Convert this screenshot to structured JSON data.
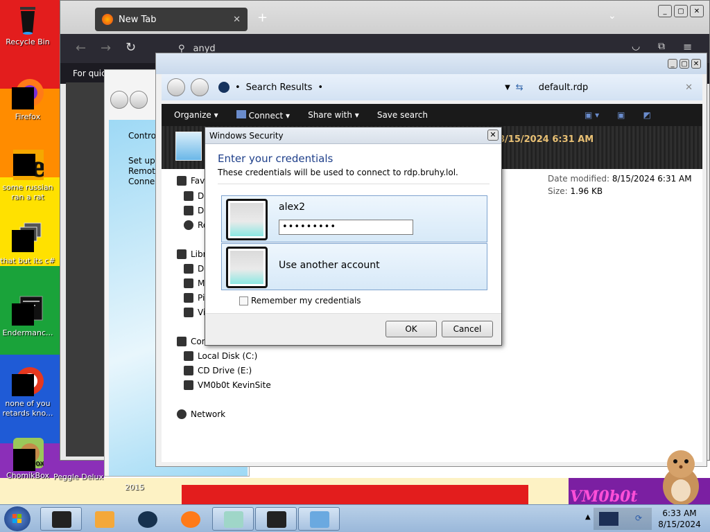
{
  "colors": {
    "accent": "#1e3f8a",
    "stripes": [
      "#e31d1d",
      "#ff8c00",
      "#ffe100",
      "#1aa33a",
      "#1f5bd6",
      "#8b2fb8"
    ]
  },
  "desktop": {
    "icons": [
      {
        "label": "Recycle Bin",
        "icon": "recycle-bin-icon"
      },
      {
        "label": "Firefox",
        "icon": "firefox-icon"
      },
      {
        "label": "some russian ran a rat",
        "icon": "ie-icon"
      },
      {
        "label": "that but its c#",
        "icon": "windows-stack-icon"
      },
      {
        "label": "Endermanc...",
        "icon": "terminal-icon"
      },
      {
        "label": "none of you retards kno...",
        "icon": "opera-icon"
      },
      {
        "label": "ChomikBox",
        "icon": "hamster-icon"
      }
    ],
    "partial_labels": {
      "peggle": "Peggle Delux",
      "year": "2015",
      "vm": "VM0b0t"
    }
  },
  "firefox": {
    "tab_title": "New Tab",
    "address_text": "anyd",
    "quick_text": "For quic"
  },
  "control_panel": {
    "lines": [
      "Control",
      "Set up a",
      "Remote",
      "Connect"
    ]
  },
  "explorer": {
    "address": "Search Results",
    "search_value": "default.rdp",
    "toolbar": {
      "organize": "Organize",
      "connect": "Connect",
      "share": "Share with",
      "save_search": "Save search"
    },
    "preview_date": "8/15/2024 6:31 AM",
    "nav": {
      "favorites": "Favo",
      "fav_items": [
        "De",
        "Do",
        "Re"
      ],
      "libraries": "Libr",
      "lib_items": [
        "Do",
        "M",
        "Pi",
        "Vi"
      ],
      "computer": "Con",
      "drives": [
        "Local Disk (C:)",
        "CD Drive (E:)",
        "VM0b0t KevinSite"
      ],
      "network": "Network"
    },
    "details": {
      "modified_label": "Date modified:",
      "modified_value": "8/15/2024 6:31 AM",
      "size_label": "Size:",
      "size_value": "1.96 KB"
    }
  },
  "dialog": {
    "title": "Windows Security",
    "heading": "Enter your credentials",
    "subtext": "These credentials will be used to connect to rdp.bruhy.lol.",
    "username": "alex2",
    "password_mask": "•••••••••",
    "other_account": "Use another account",
    "remember": "Remember my credentials",
    "ok": "OK",
    "cancel": "Cancel"
  },
  "taskbar": {
    "time": "6:33 AM",
    "date": "8/15/2024"
  }
}
